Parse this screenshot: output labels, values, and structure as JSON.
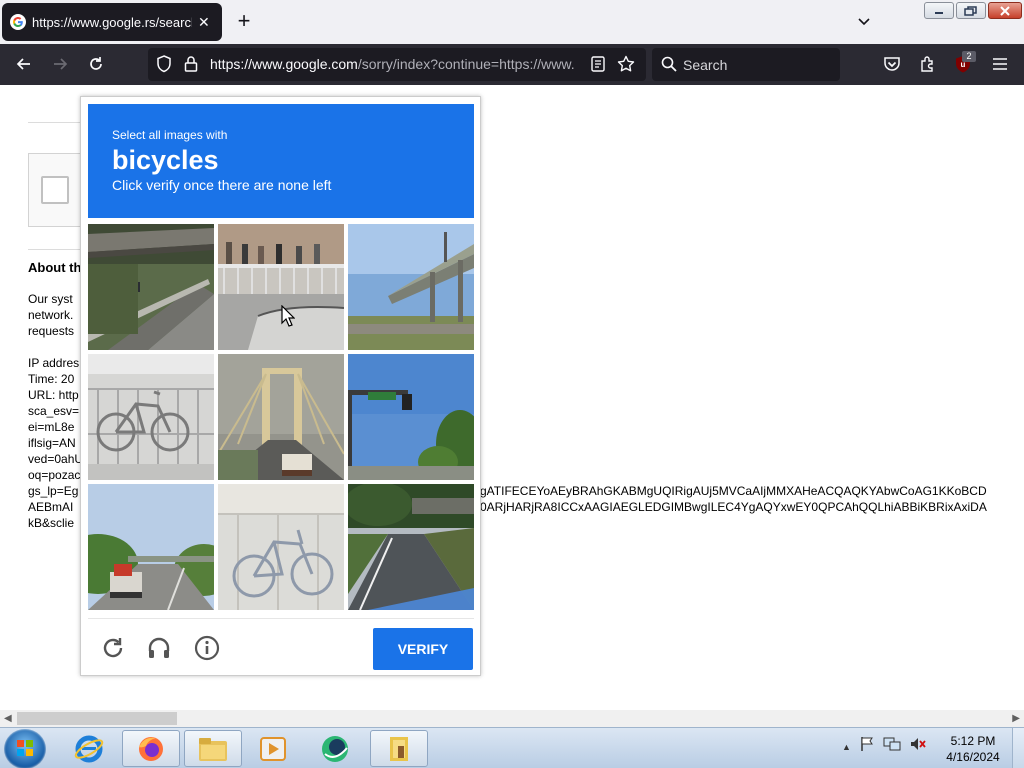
{
  "browser": {
    "tab_title": "https://www.google.rs/search?",
    "new_tab_label": "+",
    "url_host": "https://www.google.com",
    "url_path": "/sorry/index?continue=https://www.",
    "search_placeholder": "Search",
    "extension_badge": "2"
  },
  "page": {
    "about_heading": "About th",
    "left_lines": [
      "Our syst",
      "network.",
      "requests",
      "",
      "IP addres",
      "Time: 20",
      "URL: http",
      "sca_esv=",
      "ei=mL8e",
      "iflsig=AN",
      "ved=0ahU",
      "oq=pozac",
      "gs_lp=Eg",
      "AEBmAI",
      "kB&sclie"
    ],
    "right_lines": [
      "gATIFECEYoAEyBRAhGKABMgUQIRigAUj5MVCaAIjMMXAHeACQAQKYAbwCoAG1KKoBCD",
      "0ARjHARjRA8ICCxAAGIAEGLEDGIMBwgILEC4YgAQYxwEY0QPCAhQQLhiABBiKBRixAxiDA"
    ]
  },
  "captcha": {
    "subtitle": "Select all images with",
    "target": "bicycles",
    "instruction": "Click verify once there are none left",
    "verify_label": "VERIFY",
    "tiles": [
      {
        "name": "captcha-tile-overpass-road"
      },
      {
        "name": "captcha-tile-railing-crowd"
      },
      {
        "name": "captcha-tile-highway-bridge"
      },
      {
        "name": "captcha-tile-bicycle-fence"
      },
      {
        "name": "captcha-tile-suspension-bridge"
      },
      {
        "name": "captcha-tile-traffic-light"
      },
      {
        "name": "captcha-tile-truck-highway"
      },
      {
        "name": "captcha-tile-faded-bicycle"
      },
      {
        "name": "captcha-tile-road-overpass"
      }
    ],
    "colors": {
      "header": "#1a73e8",
      "button": "#1a73e8"
    }
  },
  "taskbar": {
    "time": "5:12 PM",
    "date": "4/16/2024",
    "apps": [
      "internet-explorer",
      "firefox",
      "file-explorer",
      "media-player",
      "app-green",
      "folder-app"
    ]
  }
}
